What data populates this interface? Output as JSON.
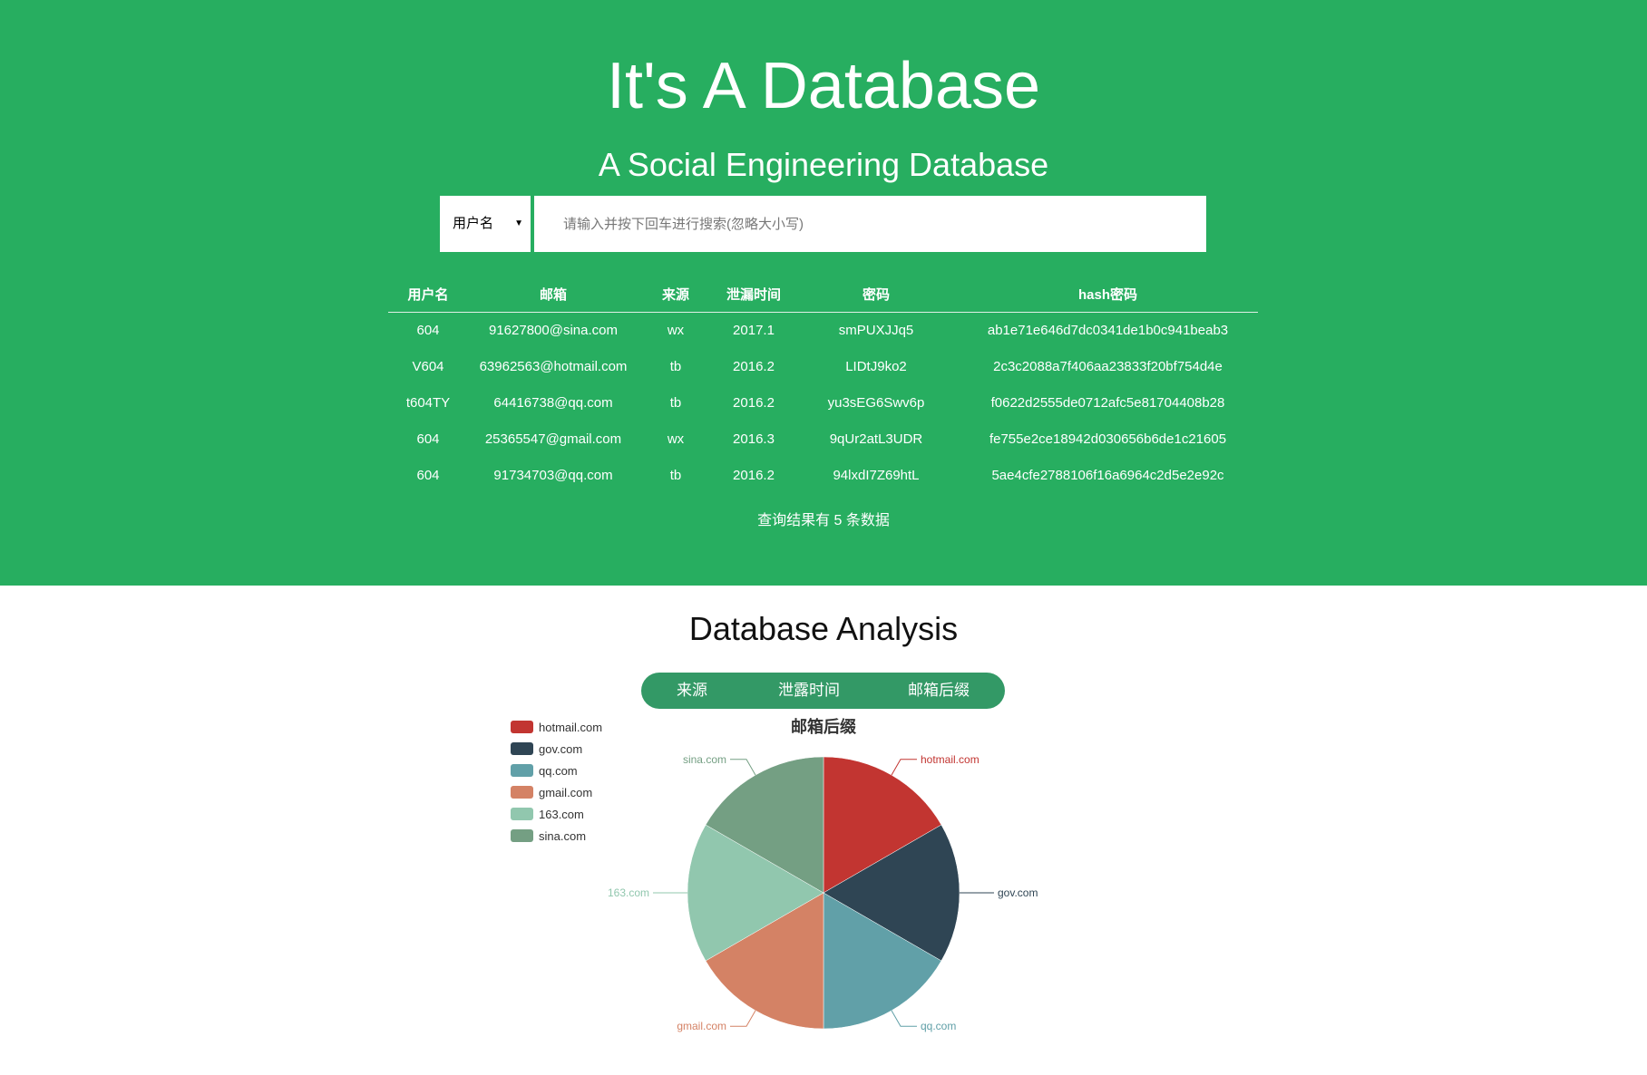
{
  "header": {
    "title": "It's A Database",
    "subtitle": "A Social Engineering Database"
  },
  "search": {
    "field_selected": "用户名",
    "placeholder": "请输入并按下回车进行搜索(忽略大小写)",
    "value": ""
  },
  "table": {
    "columns": [
      "用户名",
      "邮箱",
      "来源",
      "泄漏时间",
      "密码",
      "hash密码"
    ],
    "rows": [
      [
        "604",
        "91627800@sina.com",
        "wx",
        "2017.1",
        "smPUXJJq5",
        "ab1e71e646d7dc0341de1b0c941beab3"
      ],
      [
        "V604",
        "63962563@hotmail.com",
        "tb",
        "2016.2",
        "LIDtJ9ko2",
        "2c3c2088a7f406aa23833f20bf754d4e"
      ],
      [
        "t604TY",
        "64416738@qq.com",
        "tb",
        "2016.2",
        "yu3sEG6Swv6p",
        "f0622d2555de0712afc5e81704408b28"
      ],
      [
        "604",
        "25365547@gmail.com",
        "wx",
        "2016.3",
        "9qUr2atL3UDR",
        "fe755e2ce18942d030656b6de1c21605"
      ],
      [
        "604",
        "91734703@qq.com",
        "tb",
        "2016.2",
        "94lxdI7Z69htL",
        "5ae4cfe2788106f16a6964c2d5e2e92c"
      ]
    ],
    "summary": "查询结果有 5 条数据"
  },
  "analysis": {
    "title": "Database Analysis",
    "tabs": [
      "来源",
      "泄露时间",
      "邮箱后缀"
    ],
    "active_tab": "邮箱后缀"
  },
  "chart_data": {
    "type": "pie",
    "title": "邮箱后缀",
    "categories": [
      "hotmail.com",
      "gov.com",
      "qq.com",
      "gmail.com",
      "163.com",
      "sina.com"
    ],
    "values": [
      1,
      1,
      1,
      1,
      1,
      1
    ],
    "colors": [
      "#c23531",
      "#2f4554",
      "#61a0a8",
      "#d48265",
      "#91c7ae",
      "#749f83"
    ],
    "legend_position": "top-left"
  }
}
